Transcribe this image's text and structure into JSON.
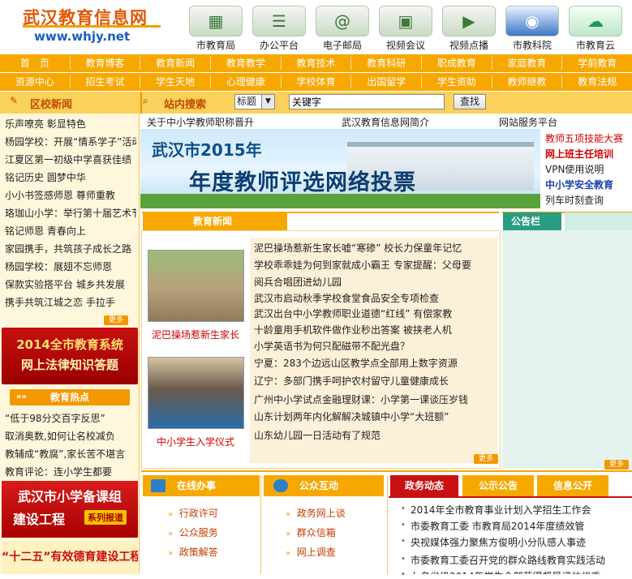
{
  "header": {
    "logo_title": "武汉教育信息网",
    "logo_url": "www.whjy.net",
    "icons": [
      {
        "label": "市教育局",
        "icon": "building-icon"
      },
      {
        "label": "办公平台",
        "icon": "office-icon"
      },
      {
        "label": "电子邮局",
        "icon": "email-icon"
      },
      {
        "label": "视频会议",
        "icon": "video-conference-icon"
      },
      {
        "label": "视频点播",
        "icon": "video-on-demand-icon"
      },
      {
        "label": "市教科院",
        "icon": "institute-logo-icon"
      },
      {
        "label": "市教育云",
        "icon": "education-cloud-icon"
      }
    ]
  },
  "nav1": [
    "首　页",
    "教育博客",
    "教育新闻",
    "教育教学",
    "教育技术",
    "教育科研",
    "职成教育",
    "家庭教育",
    "学前教育"
  ],
  "nav2": [
    "资源中心",
    "招生考试",
    "学生天地",
    "心理健康",
    "学校体育",
    "出国留学",
    "学生资助",
    "教师继教",
    "教育法规"
  ],
  "section_bar": {
    "district_news": "区校新闻",
    "site_search": "站内搜索",
    "search_select": "标题",
    "search_placeholder": "关键字",
    "search_button": "查找"
  },
  "district_news": [
    "乐声嘹亮 彰显特色",
    "杨园学校：开展“情系学子”活动",
    "江夏区第一初级中学喜获佳绩",
    "铭记历史 圆梦中华",
    "小小书签感师恩 尊师重教",
    "珞珈山小学：举行第十届艺术节",
    "铭记师恩 青春向上",
    "家园携手，共筑孩子成长之路",
    "杨园学校：展翅不忘师恩",
    "保款实验搭平台 城乡共发展",
    "携手共筑江城之恋 手拉手"
  ],
  "more_label": "更多",
  "left_banner1": {
    "line1": "2014全市教育系统",
    "line2": "网上法律知识答题"
  },
  "hot_title": "教育热点",
  "hot_items": [
    "“低于98分交百字反思”",
    "取消奥数,如何让名校减负",
    "教辅成“教腐”,家长苦不堪言",
    "教育评论：连小学生都要"
  ],
  "left_banner2": {
    "line1": "武汉市小学备课组",
    "line2": "建设工程",
    "tag": "系列报道"
  },
  "left_banner3": "“十二五”有效德育建设工程",
  "top_links": [
    "关于中小学教师职称晋升",
    "武汉教育信息网简介",
    "网站服务平台"
  ],
  "main_banner": {
    "line1": "武汉市2015年",
    "line2": "年度教师评选网络投票"
  },
  "right_links": [
    {
      "text": "教师五项技能大赛",
      "color": "#d00000"
    },
    {
      "text": "网上班主任培训",
      "color": "#d00000"
    },
    {
      "text": "VPN使用说明",
      "color": "#222222"
    },
    {
      "text": "中小学安全教育",
      "color": "#1a3fb0"
    },
    {
      "text": "列车时刻查询",
      "color": "#222222"
    }
  ],
  "edu_news_title": "教育新闻",
  "notice_title": "公告栏",
  "photo_captions": [
    "泥巴操场惹新生家长",
    "中小学生入学仪式"
  ],
  "news_items": [
    "泥巴操场惹新生家长嘘“寒碜” 校长力保童年记忆",
    "学校乖乖娃为何到家就成小霸王 专家提醒：父母要",
    "阅兵合唱团进幼儿园",
    "武汉市启动秋季学校食堂食品安全专项检查",
    "武汉出台中小学教师职业道德“红线” 有偿家教",
    "十龄童用手机软件做作业秒出答案 被挟老人机",
    "小学英语书为何只配磁带不配光盘？",
    "宁夏：283个边远山区教学点全部用上数字资源",
    "辽宁：多部门携手呵护农村留守儿童健康成长",
    "广州中小学试点金融理财课：小学第一课谈压岁钱",
    "山东计划两年内化解解决城镇中小学“大班额”",
    "山东幼儿园一日活动有了规范"
  ],
  "services": {
    "online_title": "在线办事",
    "online_items": [
      "行政许可",
      "公众服务",
      "政策解答"
    ],
    "interaction_title": "公众互动",
    "interaction_items": [
      "政务网上谈",
      "群众信箱",
      "网上调查"
    ]
  },
  "gov_tabs": [
    "政务动态",
    "公示公告",
    "信息公开"
  ],
  "gov_items": [
    "2014年全市教育事业计划入学招生工作会",
    "市委教育工委 市教育局2014年度绩效管",
    "央视媒体强力聚焦方俊明小分队感人事迹",
    "市委教育工委召开党的群众路线教育实践活动",
    "九名省级2014年学生全部获得督导评估优秀"
  ],
  "colors": {
    "accent_orange": "#f7a800",
    "brand_red": "#c81010",
    "link_blue": "#1c5bc1"
  }
}
